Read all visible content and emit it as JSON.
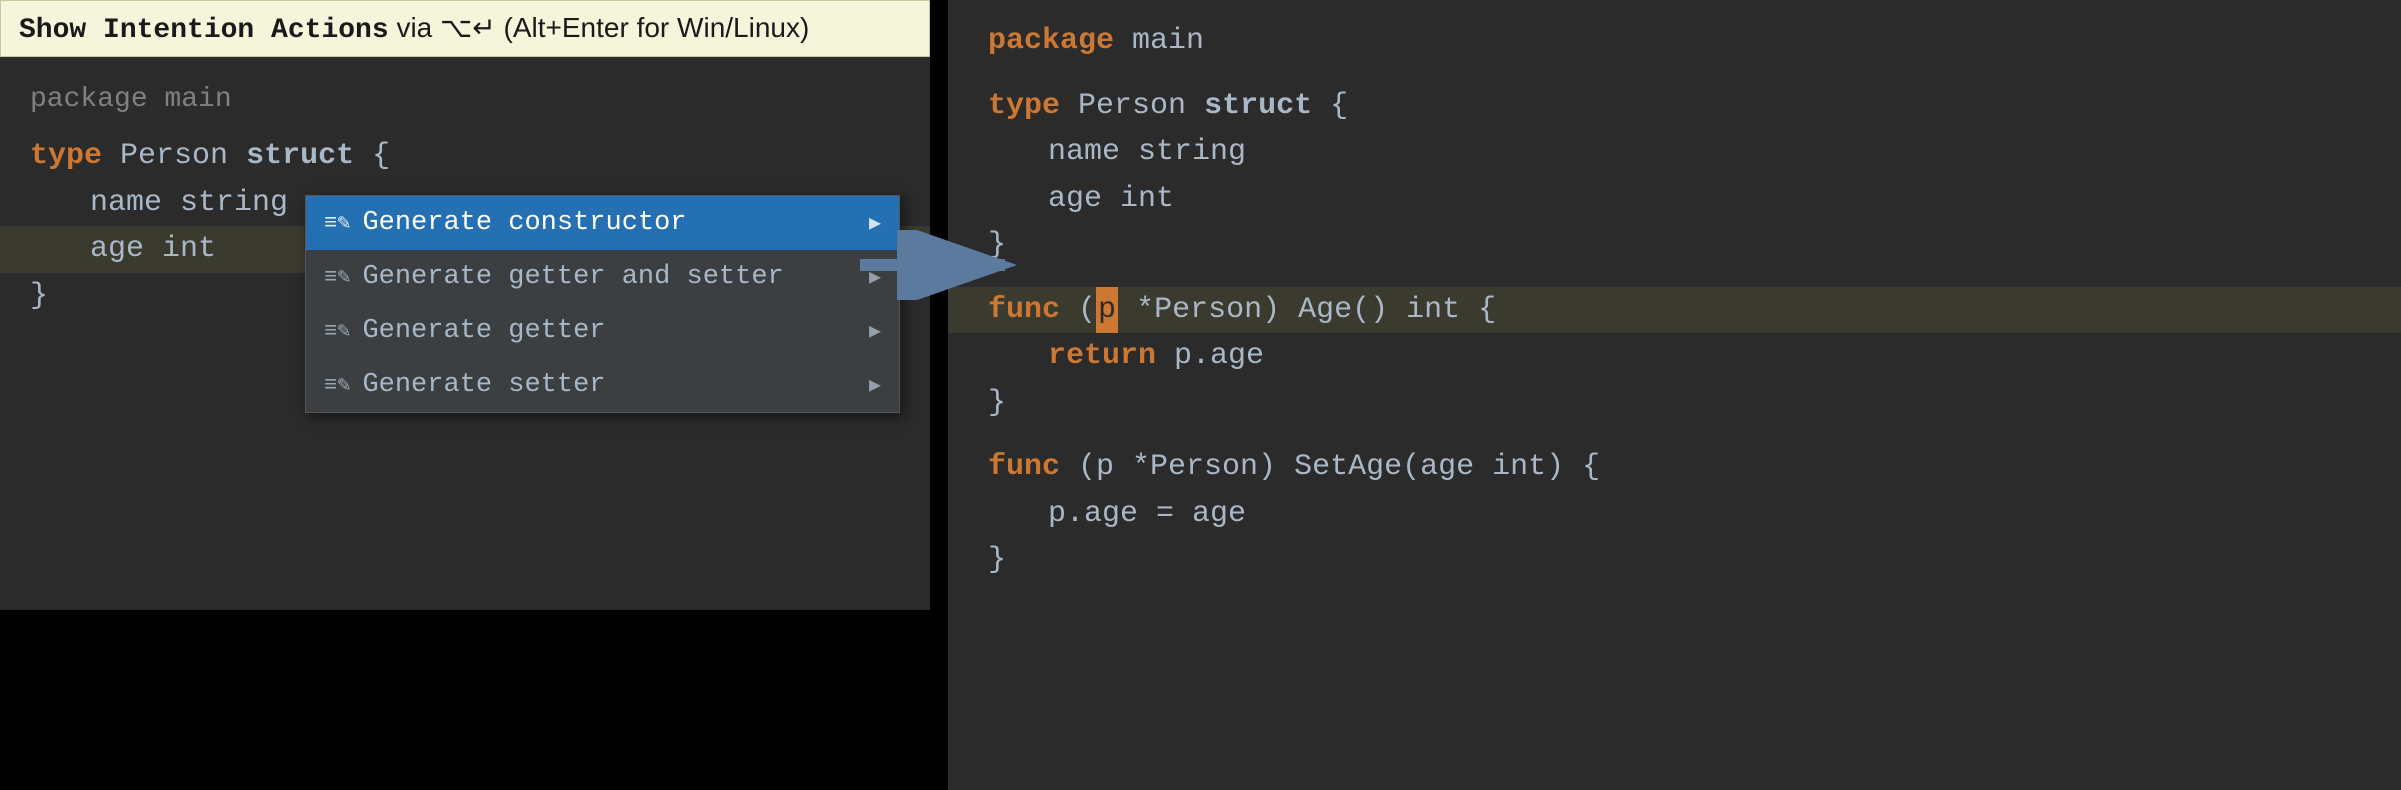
{
  "tooltip": {
    "bold_text": "Show Intention Actions",
    "shortcut_text": " via ⌥↵ (Alt+Enter for Win/Linux)"
  },
  "left_code": {
    "package_comment": "package main",
    "type_line": "type Person struct {",
    "field_name": "name string",
    "field_age": "age int",
    "close_brace": "}"
  },
  "menu": {
    "items": [
      {
        "label": "Generate constructor",
        "has_arrow": true,
        "selected": true
      },
      {
        "label": "Generate getter and setter",
        "has_arrow": true,
        "selected": false
      },
      {
        "label": "Generate getter",
        "has_arrow": true,
        "selected": false
      },
      {
        "label": "Generate setter",
        "has_arrow": true,
        "selected": false
      }
    ]
  },
  "right_code": {
    "package_line": "package main",
    "type_line": "type Person struct {",
    "field_name": "name string",
    "field_age": "age int",
    "close_brace1": "}",
    "func_age": "func (p *Person) Age() int {",
    "return_line": "return p.age",
    "close_brace2": "}",
    "func_setage": "func (p *Person) SetAge(age int) {",
    "setage_body": "p.age = age",
    "close_brace3": "}"
  },
  "icons": {
    "generate": "≡✏",
    "arrow_right": "▶"
  }
}
